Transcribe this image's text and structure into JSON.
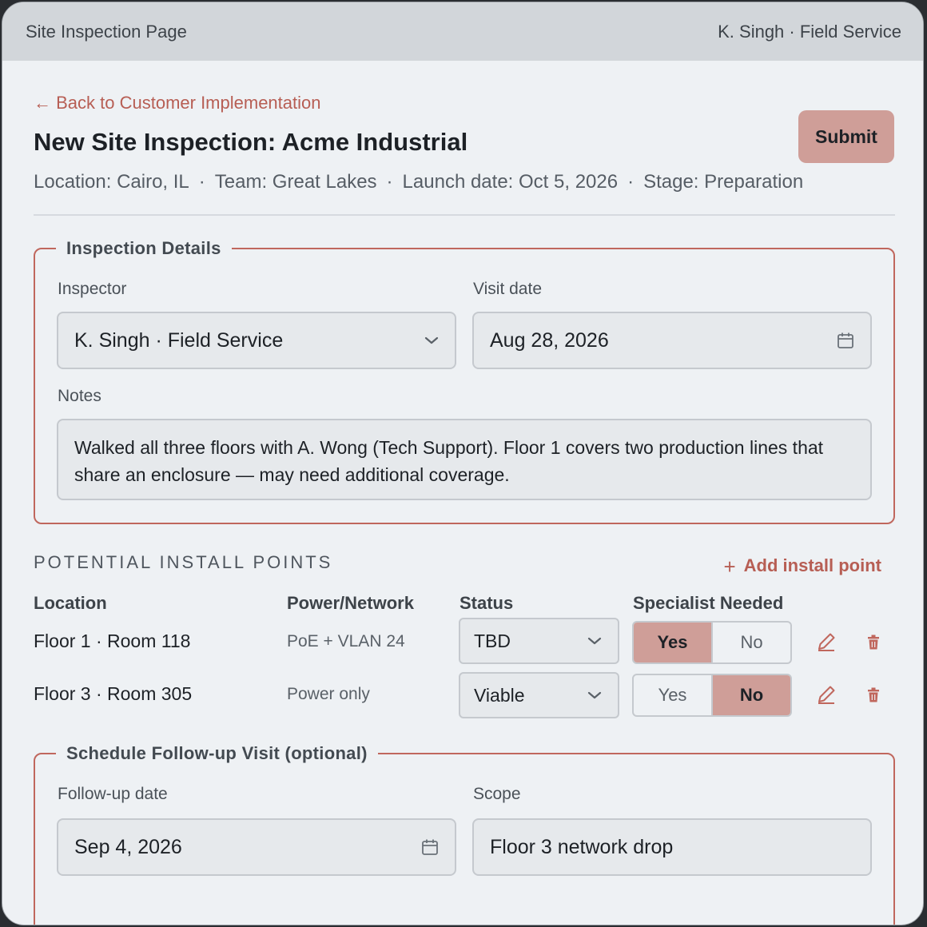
{
  "titlebar": {
    "title": "Site Inspection Page",
    "user": "K. Singh · Field Service"
  },
  "header": {
    "back_link": "← Back to Customer Implementation",
    "title": "New Site Inspection: Acme Industrial",
    "submit_label": "Submit",
    "meta": {
      "location": "Location: Cairo, IL",
      "team": "Team: Great Lakes",
      "launch_date": "Launch date: Oct 5, 2026",
      "stage": "Stage: Preparation",
      "separator": "·"
    }
  },
  "inspection_details": {
    "legend": "Inspection Details",
    "inspector_label": "Inspector",
    "inspector_value": "K. Singh · Field Service",
    "visit_date_label": "Visit date",
    "visit_date_value": "Aug 28, 2026",
    "notes_label": "Notes",
    "notes_value": "Walked all three floors with A. Wong (Tech Support). Floor 1 covers two production lines that share an enclosure — may need additional coverage."
  },
  "install_points": {
    "heading": "POTENTIAL INSTALL POINTS",
    "add_label": "Add install point",
    "add_icon": "+",
    "columns": [
      "Location",
      "Power/Network",
      "Status",
      "Specialist Needed"
    ],
    "yes_label": "Yes",
    "no_label": "No",
    "rows": [
      {
        "location": "Floor 1 · Room 118",
        "power": "PoE + VLAN 24",
        "status": "TBD",
        "specialist": "Yes"
      },
      {
        "location": "Floor 3 · Room 305",
        "power": "Power only",
        "status": "Viable",
        "specialist": "No"
      }
    ]
  },
  "follow_up": {
    "legend": "Schedule Follow-up Visit (optional)",
    "date_label": "Follow-up date",
    "date_value": "Sep 4, 2026",
    "scope_label": "Scope",
    "scope_value": "Floor 3 network drop"
  },
  "colors": {
    "accent": "#c0675d",
    "accent_fill": "#cf9e98",
    "background": "#eef1f4",
    "titlebar": "#d2d6da"
  }
}
